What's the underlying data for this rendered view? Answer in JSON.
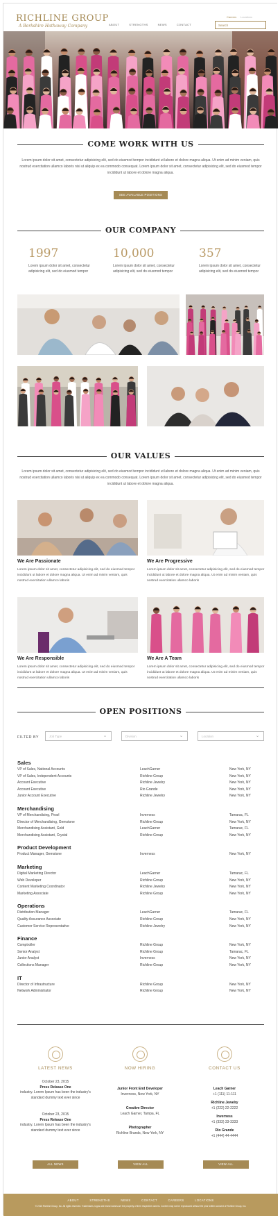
{
  "header": {
    "logo": "RICHLINE GROUP",
    "tagline": "A Berkshire Hathaway Company",
    "nav": [
      "ABOUT",
      "STRENGTHS",
      "NEWS",
      "CONTACT"
    ],
    "top_links": [
      "Careers",
      "Locations"
    ],
    "search_placeholder": "Search"
  },
  "work": {
    "title": "COME WORK WITH US",
    "text": "Lorem ipsum dolor sit amet, consectetur adipisicing elit, sed do eiusmod tempor incididunt ut labore et dolore magna aliqua. Ut enim ad minim veniam, quis nostrud exercitation ullamco laboris nisi ut aliquip ex ea commodo consequat. Lorem ipsum dolor sit amet, consectetur adipisicing elit, sed do eiusmod tempor incididunt ut labore et dolore magna aliqua.",
    "button": "SEE AVAILABLE POSITIONS"
  },
  "company": {
    "title": "OUR COMPANY",
    "stats": [
      {
        "number": "1997",
        "text": "Lorem ipsum dolor sit amet, consectetur adipisicing elit, sed do eiusmod tempor"
      },
      {
        "number": "10,000",
        "text": "Lorem ipsum dolor sit amet, consectetur adipisicing elit, sed do eiusmod tempor"
      },
      {
        "number": "357",
        "text": "Lorem ipsum dolor sit amet, consectetur adipisicing elit, sed do eiusmod tempor"
      }
    ]
  },
  "values": {
    "title": "OUR VALUES",
    "text": "Lorem ipsum dolor sit amet, consectetur adipisicing elit, sed do eiusmod tempor incididunt ut labore et dolore magna aliqua. Ut enim ad minim veniam, quis nostrud exercitation ullamco laboris nisi ut aliquip ex ea commodo consequat. Lorem ipsum dolor sit amet, consectetur adipisicing elit, sed do eiusmod tempor incididunt ut labore et dolore magna aliqua.",
    "items": [
      {
        "title": "We Are Passionate",
        "text": "Lorem ipsum dolor sit amet, consectetur adipisicing elit, sed do eiusmod tempor incididunt ut labore et dolore magna aliqua. Ut enim ad minim veniam, quis nostrud exercitation ullamco laboris"
      },
      {
        "title": "We Are Progressive",
        "text": "Lorem ipsum dolor sit amet, consectetur adipisicing elit, sed do eiusmod tempor incididunt ut labore et dolore magna aliqua. Ut enim ad minim veniam, quis nostrud exercitation ullamco laboris"
      },
      {
        "title": "We Are Responsible",
        "text": "Lorem ipsum dolor sit amet, consectetur adipisicing elit, sed do eiusmod tempor incididunt ut labore et dolore magna aliqua. Ut enim ad minim veniam, quis nostrud exercitation ullamco laboris"
      },
      {
        "title": "We Are A Team",
        "text": "Lorem ipsum dolor sit amet, consectetur adipisicing elit, sed do eiusmod tempor incididunt ut labore et dolore magna aliqua. Ut enim ad minim veniam, quis nostrud exercitation ullamco laboris"
      }
    ]
  },
  "positions": {
    "title": "OPEN POSITIONS",
    "filter_label": "FILTER BY",
    "filters": [
      "Job Type",
      "Division",
      "Location"
    ],
    "categories": [
      {
        "name": "Sales",
        "jobs": [
          [
            "VP of Sales, National Accounts",
            "LeachGarner",
            "New York, NY"
          ],
          [
            "VP of Sales, Independent Accounts",
            "Richline Group",
            "New York, NY"
          ],
          [
            "Account Executive",
            "Richline Jewelry",
            "New York, NY"
          ],
          [
            "Account Executive",
            "Rio Grande",
            "New York, NY"
          ],
          [
            "Junior Account Executive",
            "Richline Jewelry",
            "New York, NY"
          ]
        ]
      },
      {
        "name": "Merchandising",
        "jobs": [
          [
            "VP of Merchandising, Pearl",
            "Inverness",
            "Tamarac, FL"
          ],
          [
            "Director of Merchandising, Gemstone",
            "Richline Group",
            "New York, NY"
          ],
          [
            "Merchandising Assistant, Gold",
            "LeachGarner",
            "Tamarac, FL"
          ],
          [
            "Merchandising Assistant, Crystal",
            "Richline Group",
            "New York, NY"
          ]
        ]
      },
      {
        "name": "Product Development",
        "jobs": [
          [
            "Product Manager, Gemstone",
            "Inverness",
            "New York, NY"
          ]
        ]
      },
      {
        "name": "Marketing",
        "jobs": [
          [
            "Digital Marketing Director",
            "LeachGarner",
            "Tamarac, FL"
          ],
          [
            "Web Developer",
            "Richline Group",
            "New York, NY"
          ],
          [
            "Content Marketing Coordinator",
            "Richline Jewelry",
            "New York, NY"
          ],
          [
            "Marketing Associate",
            "Richline Group",
            "New York, NY"
          ]
        ]
      },
      {
        "name": "Operations",
        "jobs": [
          [
            "Distribution Manager",
            "LeachGarner",
            "Tamarac, FL"
          ],
          [
            "Quality Assurance Associate",
            "Richline Group",
            "New York, NY"
          ],
          [
            "Customer Service Representative",
            "Richline Jewelry",
            "New York, NY"
          ]
        ]
      },
      {
        "name": "Finance",
        "jobs": [
          [
            "Comptroller",
            "Richline Group",
            "New York, NY"
          ],
          [
            "Senior Analyst",
            "Richline Group",
            "Tamarac, FL"
          ],
          [
            "Junior Analyst",
            "Inverness",
            "New York, NY"
          ],
          [
            "Collections Manager",
            "Richline Group",
            "New York, NY"
          ]
        ]
      },
      {
        "name": "IT",
        "jobs": [
          [
            "Director of Infrastructure",
            "Richline Group",
            "New York, NY"
          ],
          [
            "Network Administrator",
            "Richline Group",
            "New York, NY"
          ]
        ]
      }
    ]
  },
  "news": {
    "title": "LATEST NEWS",
    "items": [
      {
        "date": "October 23, 2015",
        "title": "Press Release One",
        "text": "industry. Lorem Ipsum has been the industry's standard dummy text ever since"
      },
      {
        "date": "October 23, 2015",
        "title": "Press Release One",
        "text": "industry. Lorem Ipsum has been the industry's standard dummy text ever since"
      }
    ],
    "button": "ALL NEWS"
  },
  "hiring": {
    "title": "NOW HIRING",
    "items": [
      {
        "title": "Junior Front End Developer",
        "place": "Inverness, New York, NY"
      },
      {
        "title": "Creative Director",
        "place": "Leach Garner, Tampa, FL"
      },
      {
        "title": "Photographer",
        "place": "Richline Brands, New York, NY"
      }
    ],
    "button": "VIEW ALL"
  },
  "contact": {
    "title": "CONTACT US",
    "items": [
      {
        "name": "Leach Garner",
        "phone": "+1 (111) 11-111"
      },
      {
        "name": "Richline Jewelry",
        "phone": "+1 (222) 22-2222"
      },
      {
        "name": "Inverness",
        "phone": "+1 (333) 33-3333"
      },
      {
        "name": "Rio Grande",
        "phone": "+1 (444) 44-4444"
      }
    ],
    "button": "VIEW ALL"
  },
  "footer": {
    "nav": [
      "ABOUT",
      "STRENGTHS",
      "NEWS",
      "CONTACT",
      "CAREERS",
      "LOCATIONS"
    ],
    "copyright": "© 2015 Richline Group, Inc. All rights reserved. Trademarks, logos and brand names are the property of their respective owners. Content may not be reproduced without the prior written consent of Richline Group, Inc."
  },
  "colors": {
    "gold": "#a58a55",
    "footer": "#b89a5e",
    "text": "#333333"
  }
}
